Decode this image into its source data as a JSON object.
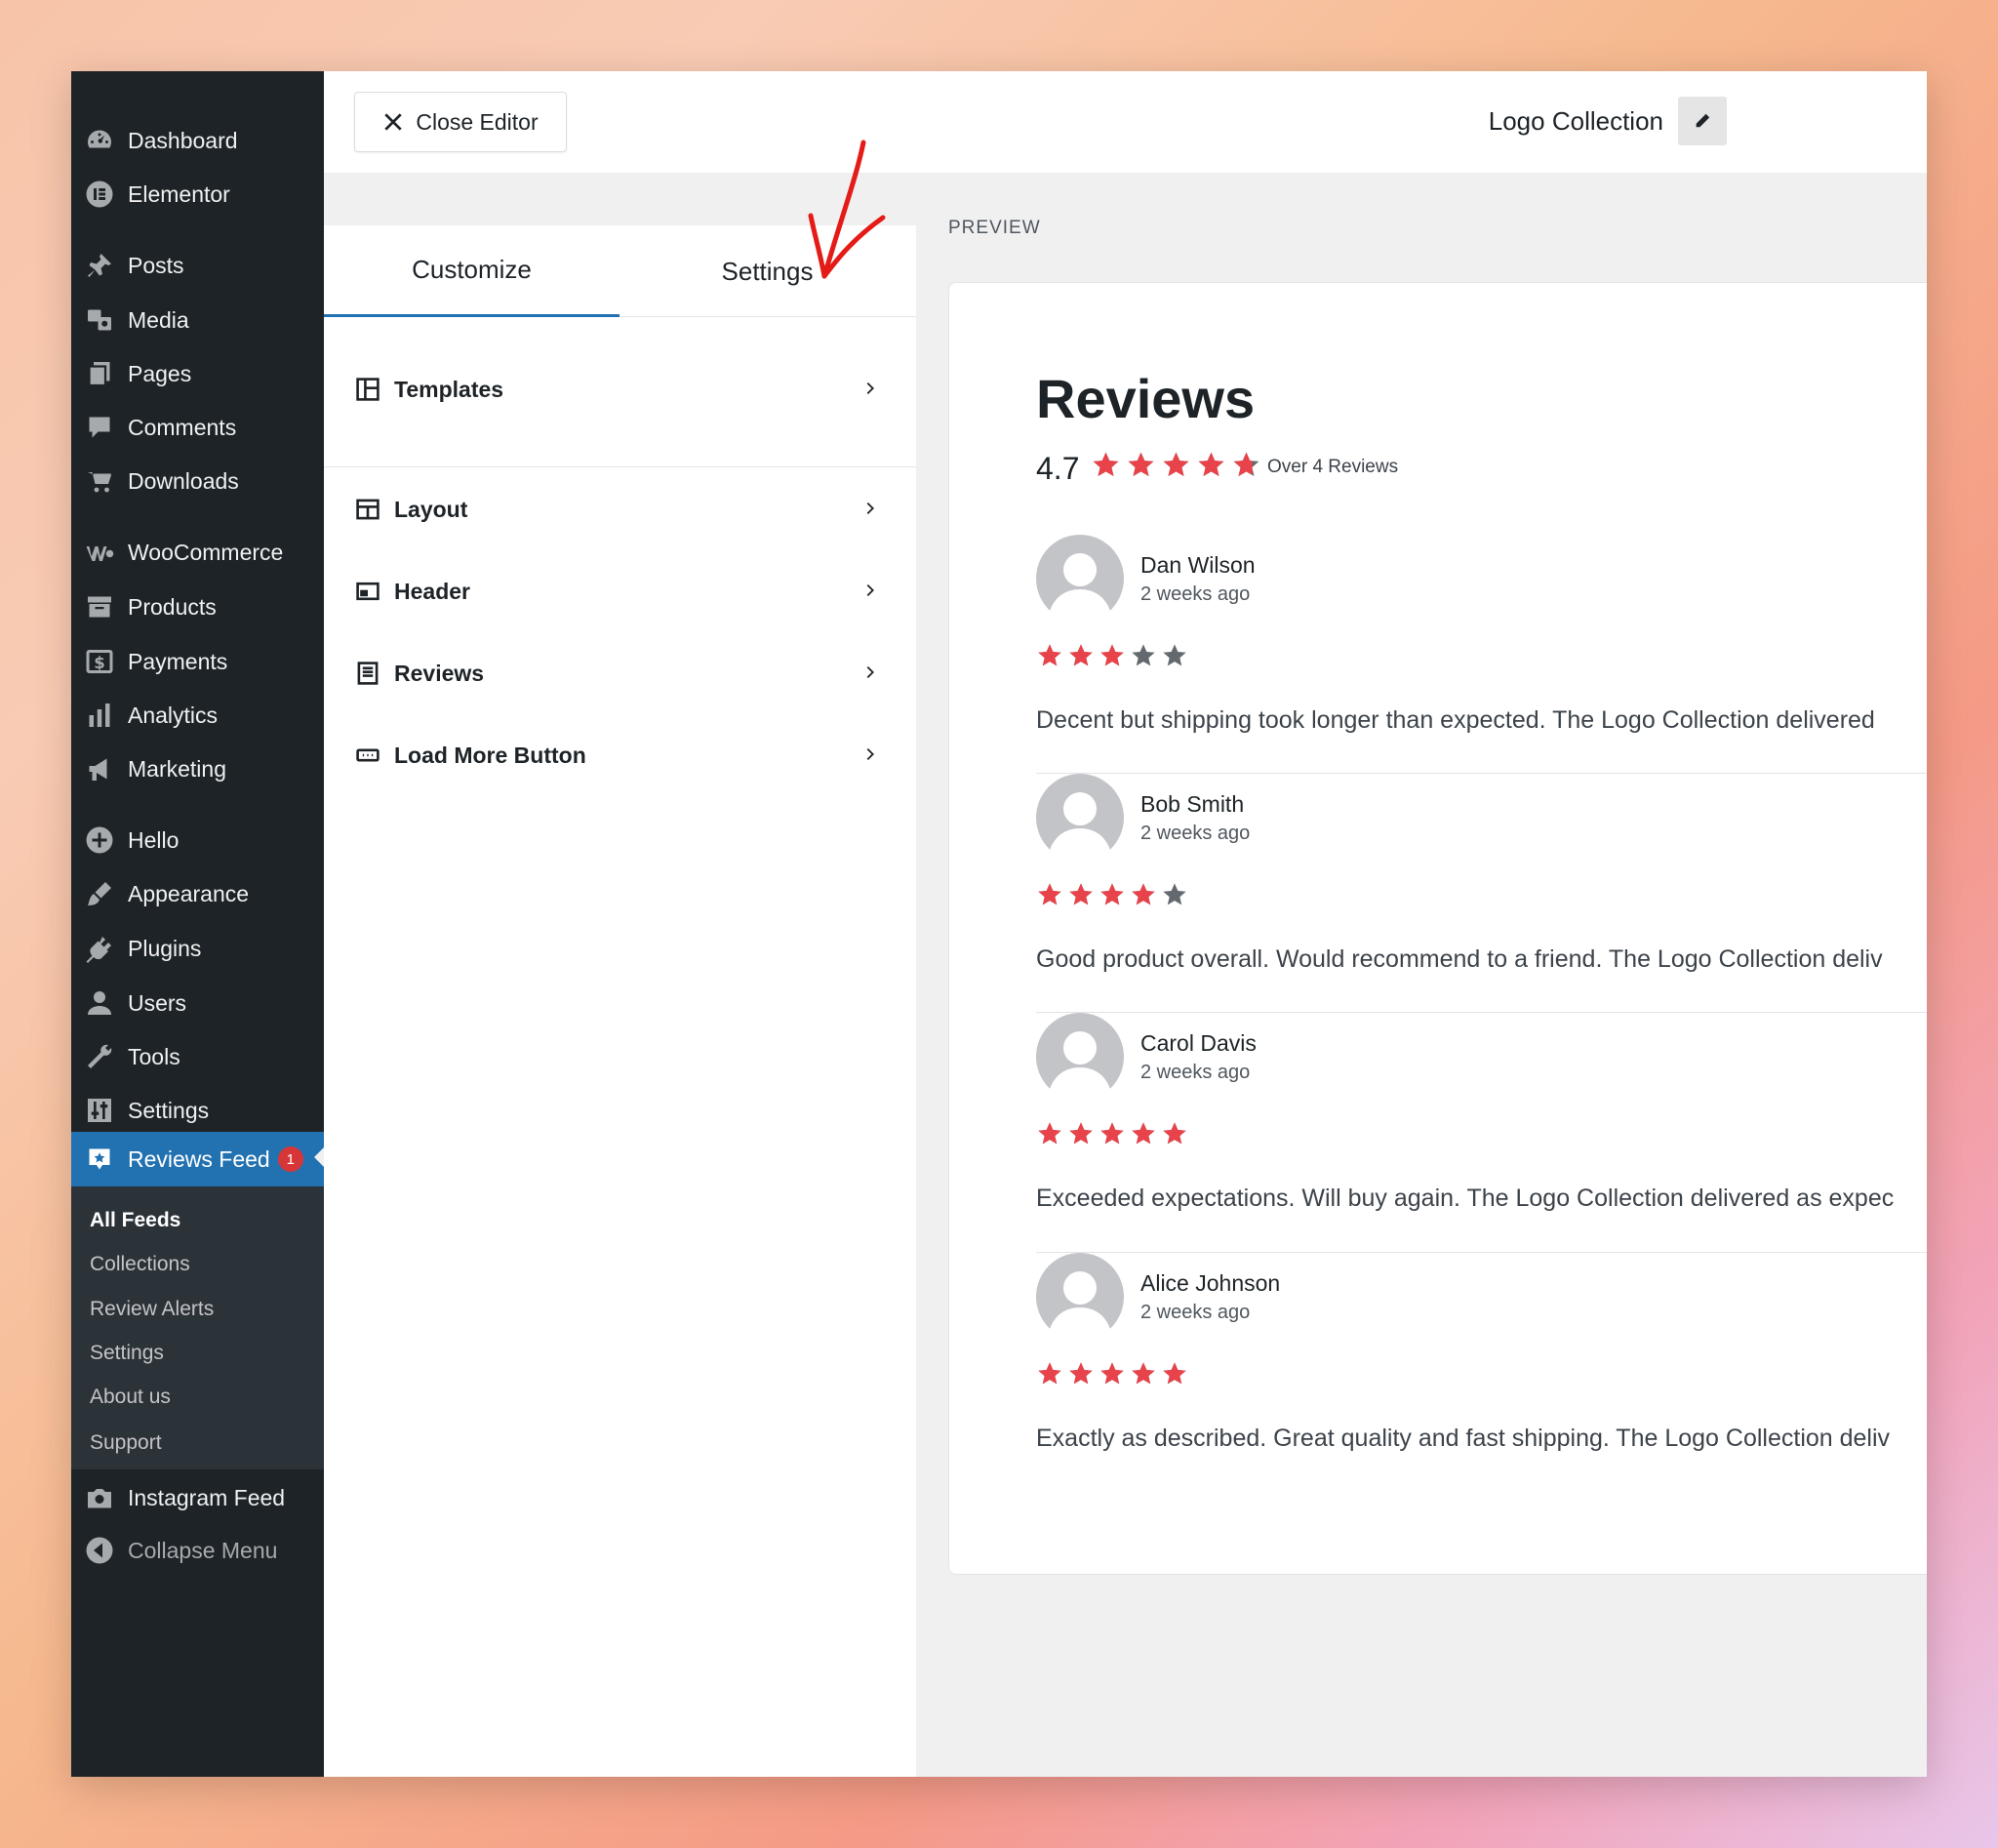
{
  "sidebar": {
    "items": [
      {
        "label": "Dashboard",
        "icon": "dashboard-icon"
      },
      {
        "label": "Elementor",
        "icon": "elementor-icon"
      },
      {
        "label": "Posts",
        "icon": "pin-icon"
      },
      {
        "label": "Media",
        "icon": "media-icon"
      },
      {
        "label": "Pages",
        "icon": "pages-icon"
      },
      {
        "label": "Comments",
        "icon": "comment-icon"
      },
      {
        "label": "Downloads",
        "icon": "cart-icon"
      },
      {
        "label": "WooCommerce",
        "icon": "woo-icon"
      },
      {
        "label": "Products",
        "icon": "archive-icon"
      },
      {
        "label": "Payments",
        "icon": "dollar-icon"
      },
      {
        "label": "Analytics",
        "icon": "bar-chart-icon"
      },
      {
        "label": "Marketing",
        "icon": "megaphone-icon"
      },
      {
        "label": "Hello",
        "icon": "plus-circle-icon"
      },
      {
        "label": "Appearance",
        "icon": "brush-icon"
      },
      {
        "label": "Plugins",
        "icon": "plug-icon"
      },
      {
        "label": "Users",
        "icon": "user-icon"
      },
      {
        "label": "Tools",
        "icon": "wrench-icon"
      },
      {
        "label": "Settings",
        "icon": "sliders-icon"
      },
      {
        "label": "Reviews Feed",
        "icon": "star-badge-icon",
        "badge": "1"
      },
      {
        "label": "Instagram Feed",
        "icon": "camera-icon"
      },
      {
        "label": "Collapse Menu",
        "icon": "collapse-icon"
      }
    ],
    "submenu": [
      {
        "label": "All Feeds"
      },
      {
        "label": "Collections"
      },
      {
        "label": "Review Alerts"
      },
      {
        "label": "Settings"
      },
      {
        "label": "About us"
      },
      {
        "label": "Support"
      }
    ]
  },
  "topbar": {
    "close_label": "Close Editor",
    "feed_title": "Logo Collection"
  },
  "panel": {
    "tabs": [
      {
        "label": "Customize"
      },
      {
        "label": "Settings"
      }
    ],
    "sections": [
      {
        "label": "Templates"
      },
      {
        "label": "Layout"
      },
      {
        "label": "Header"
      },
      {
        "label": "Reviews"
      },
      {
        "label": "Load More Button"
      }
    ]
  },
  "preview": {
    "label": "PREVIEW",
    "title": "Reviews",
    "rating": "4.7",
    "rating_value": 4.7,
    "rating_count": "Over 4 Reviews",
    "reviews": [
      {
        "name": "Dan Wilson",
        "time": "2 weeks ago",
        "stars": 3,
        "text": "Decent but shipping took longer than expected. The Logo Collection delivered"
      },
      {
        "name": "Bob Smith",
        "time": "2 weeks ago",
        "stars": 4,
        "text": "Good product overall. Would recommend to a friend. The Logo Collection deliv"
      },
      {
        "name": "Carol Davis",
        "time": "2 weeks ago",
        "stars": 5,
        "text": "Exceeded expectations. Will buy again. The Logo Collection delivered as expec"
      },
      {
        "name": "Alice Johnson",
        "time": "2 weeks ago",
        "stars": 5,
        "text": "Exactly as described. Great quality and fast shipping. The Logo Collection deliv"
      }
    ]
  },
  "colors": {
    "accent": "#2271b1",
    "star_filled": "#e8434a",
    "star_empty": "#646970",
    "sidebar_bg": "#1d2327",
    "annotation": "#e41b17"
  }
}
